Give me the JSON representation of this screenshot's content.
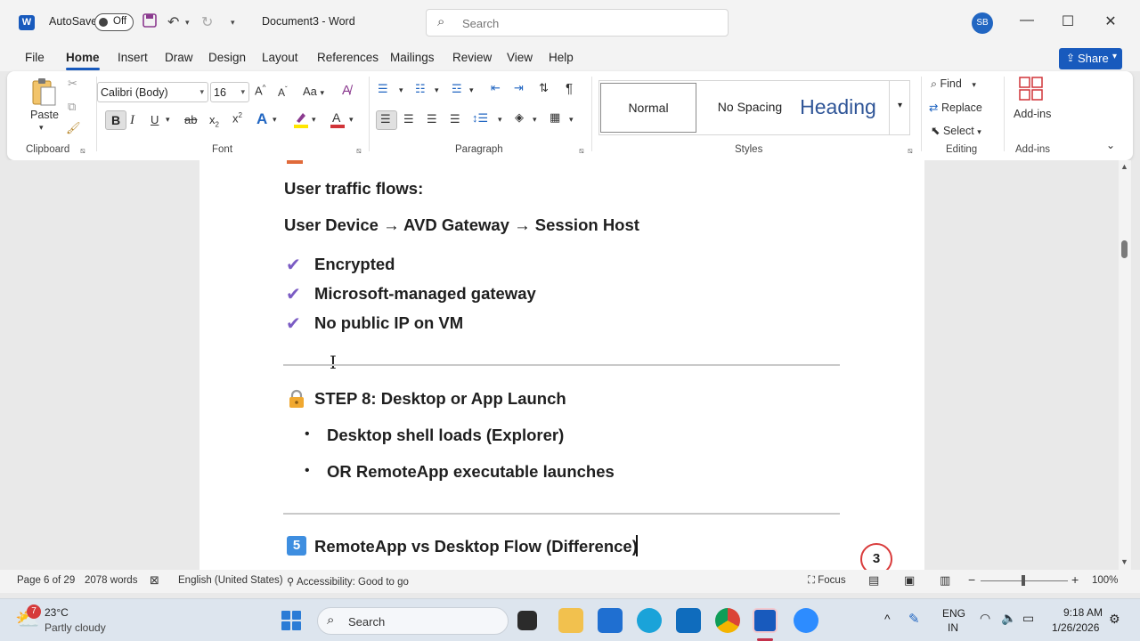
{
  "titlebar": {
    "autosave_label": "AutoSave",
    "autosave_state": "Off",
    "doc_title": "Document3  -  Word",
    "search_placeholder": "Search",
    "user_initials": "SB"
  },
  "menu": {
    "tabs": [
      "File",
      "Home",
      "Insert",
      "Draw",
      "Design",
      "Layout",
      "References",
      "Mailings",
      "Review",
      "View",
      "Help"
    ],
    "active_tab": "Home",
    "share_label": "Share"
  },
  "ribbon": {
    "clipboard": {
      "paste_label": "Paste",
      "group_label": "Clipboard"
    },
    "font": {
      "font_name": "Calibri (Body)",
      "font_size": "16",
      "group_label": "Font",
      "change_case": "Aa"
    },
    "paragraph": {
      "group_label": "Paragraph"
    },
    "styles": {
      "normal": "Normal",
      "no_spacing": "No Spacing",
      "heading": "Heading",
      "group_label": "Styles"
    },
    "editing": {
      "find": "Find",
      "replace": "Replace",
      "select": "Select",
      "group_label": "Editing"
    },
    "addins": {
      "label": "Add-ins",
      "group_label": "Add-ins"
    }
  },
  "document": {
    "traffic_heading": "User traffic flows:",
    "flow_line": "User Device → AVD Gateway → Session Host",
    "checks": [
      "Encrypted",
      "Microsoft-managed gateway",
      "No public IP on VM"
    ],
    "step8_heading": "STEP 8: Desktop or App Launch",
    "step8_bullets": [
      "Desktop shell loads (Explorer)",
      "OR RemoteApp executable launches"
    ],
    "section5_heading": "RemoteApp vs Desktop Flow (Difference)",
    "section5_number": "5"
  },
  "notification_badge": "3",
  "statusbar": {
    "page": "Page 6 of 29",
    "words": "2078 words",
    "language": "English (United States)",
    "accessibility": "Accessibility: Good to go",
    "focus": "Focus",
    "zoom": "100%"
  },
  "taskbar": {
    "weather_temp": "23°C",
    "weather_desc": "Partly cloudy",
    "weather_badge": "7",
    "search_label": "Search",
    "lang_line1": "ENG",
    "lang_line2": "IN",
    "time": "9:18 AM",
    "date": "1/26/2026"
  },
  "colors": {
    "word_blue": "#185abd",
    "check_purple": "#7b5cc4",
    "heading_blue": "#2f5597"
  }
}
